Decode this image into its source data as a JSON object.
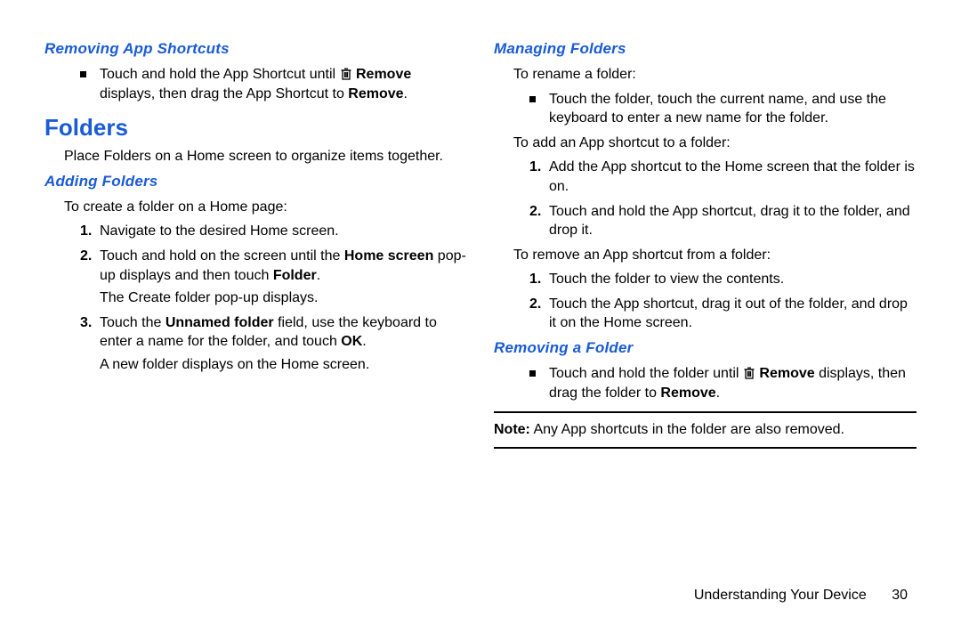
{
  "left": {
    "removing_shortcuts": {
      "heading": "Removing App Shortcuts",
      "bullet_pre": "Touch and hold the App Shortcut until ",
      "bullet_bold_remove": "Remove",
      "bullet_mid": " displays, then drag the App Shortcut to ",
      "bullet_bold_remove2": "Remove",
      "bullet_end": "."
    },
    "folders": {
      "heading": "Folders",
      "intro": "Place Folders on a Home screen to organize items together."
    },
    "adding_folders": {
      "heading": "Adding Folders",
      "intro": "To create a folder on a Home page:",
      "step1": "Navigate to the desired Home screen.",
      "step2_pre": "Touch and hold on the screen until the ",
      "step2_bold": "Home screen",
      "step2_mid": " pop-up displays and then touch ",
      "step2_bold2": "Folder",
      "step2_end": ".",
      "step2_after": "The Create folder pop-up displays.",
      "step3_pre": "Touch the ",
      "step3_bold": "Unnamed folder",
      "step3_mid": " field, use the keyboard to enter a name for the folder, and touch ",
      "step3_bold2": "OK",
      "step3_end": ".",
      "step3_after": "A new folder displays on the Home screen."
    }
  },
  "right": {
    "managing_folders": {
      "heading": "Managing Folders",
      "rename_intro": "To rename a folder:",
      "rename_bullet": "Touch the folder, touch the current name, and use the keyboard to enter a new name for the folder.",
      "add_intro": "To add an App shortcut to a folder:",
      "add_step1": "Add the App shortcut to the Home screen that the folder is on.",
      "add_step2": "Touch and hold the App shortcut, drag it to the folder, and drop it.",
      "remove_intro": "To remove an App shortcut from a folder:",
      "remove_step1": "Touch the folder to view the contents.",
      "remove_step2": "Touch the App shortcut, drag it out of the folder, and drop it on the Home screen."
    },
    "removing_folder": {
      "heading": "Removing a Folder",
      "bullet_pre": "Touch and hold the folder until ",
      "bullet_bold_remove": "Remove",
      "bullet_mid": " displays, then drag the folder to ",
      "bullet_bold_remove2": "Remove",
      "bullet_end": "."
    },
    "note": {
      "bold": "Note:",
      "text": " Any App shortcuts in the folder are also removed."
    }
  },
  "footer": {
    "section": "Understanding Your Device",
    "page": "30"
  },
  "numbers": {
    "n1": "1.",
    "n2": "2.",
    "n3": "3."
  }
}
